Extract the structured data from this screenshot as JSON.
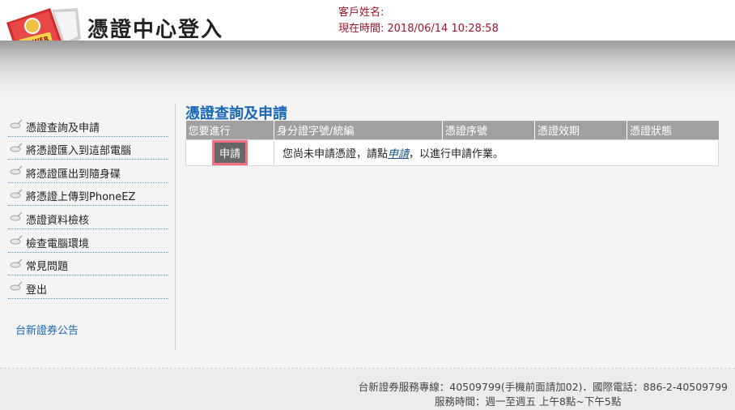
{
  "header": {
    "app_title": "憑證中心登入",
    "logo_text": "RAWER",
    "customer_label": "客戶姓名:",
    "time_label": "現在時間:",
    "time_value": "2018/06/14 10:28:58"
  },
  "sidebar": {
    "items": [
      {
        "label": "憑證查詢及申請"
      },
      {
        "label": "將憑證匯入到這部電腦"
      },
      {
        "label": "將憑證匯出到隨身碟"
      },
      {
        "label": "將憑證上傳到PhoneEZ"
      },
      {
        "label": "憑證資料檢核"
      },
      {
        "label": "檢查電腦環境"
      },
      {
        "label": "常見問題"
      },
      {
        "label": "登出"
      }
    ],
    "notice_link": "台新證券公告"
  },
  "main": {
    "section_title": "憑證查詢及申請",
    "table": {
      "headers": [
        "您要進行",
        "身分證字號/統編",
        "憑證序號",
        "憑證效期",
        "憑證狀態"
      ],
      "apply_button": "申請",
      "message_before": "您尚未申請憑證，請點",
      "message_link": "申請",
      "message_after": "，以進行申請作業。"
    }
  },
  "footer": {
    "line1": "台新證券服務專線：40509799(手機前面請加02)．國際電話：886-2-40509799",
    "line2": "服務時間：週一至週五 上午8點~下午5點"
  },
  "colors": {
    "accent_blue": "#1a66b8",
    "header_red": "#a0142a",
    "table_header": "#a0a0a0",
    "button_highlight": "#f2707e"
  }
}
